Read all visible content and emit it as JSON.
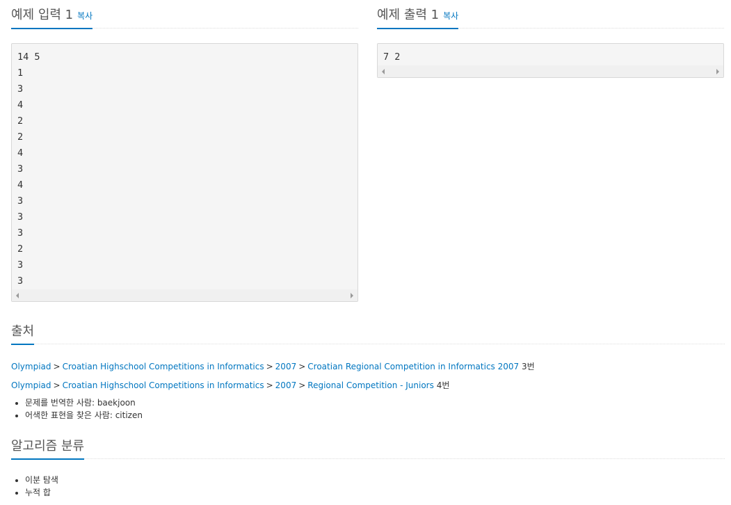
{
  "sample_input": {
    "title": "예제 입력 1",
    "copy": "복사",
    "lines": [
      "14 5",
      "1",
      "3",
      "4",
      "2",
      "2",
      "4",
      "3",
      "4",
      "3",
      "3",
      "3",
      "2",
      "3",
      "3"
    ]
  },
  "sample_output": {
    "title": "예제 출력 1",
    "copy": "복사",
    "lines": [
      "7 2"
    ]
  },
  "source": {
    "title": "출처",
    "lines": [
      {
        "links": [
          "Olympiad",
          "Croatian Highschool Competitions in Informatics",
          "2007",
          "Croatian Regional Competition in Informatics 2007"
        ],
        "suffix": "3번"
      },
      {
        "links": [
          "Olympiad",
          "Croatian Highschool Competitions in Informatics",
          "2007",
          "Regional Competition - Juniors"
        ],
        "suffix": "4번"
      }
    ],
    "credits": [
      {
        "label": "문제를 번역한 사람: ",
        "user": "baekjoon"
      },
      {
        "label": "어색한 표현을 찾은 사람: ",
        "user": "citizen"
      }
    ]
  },
  "algorithm": {
    "title": "알고리즘 분류",
    "tags": [
      "이분 탐색",
      "누적 합"
    ]
  },
  "colors": {
    "accent": "#0076c0",
    "sample_bg": "#f5f5f5"
  }
}
